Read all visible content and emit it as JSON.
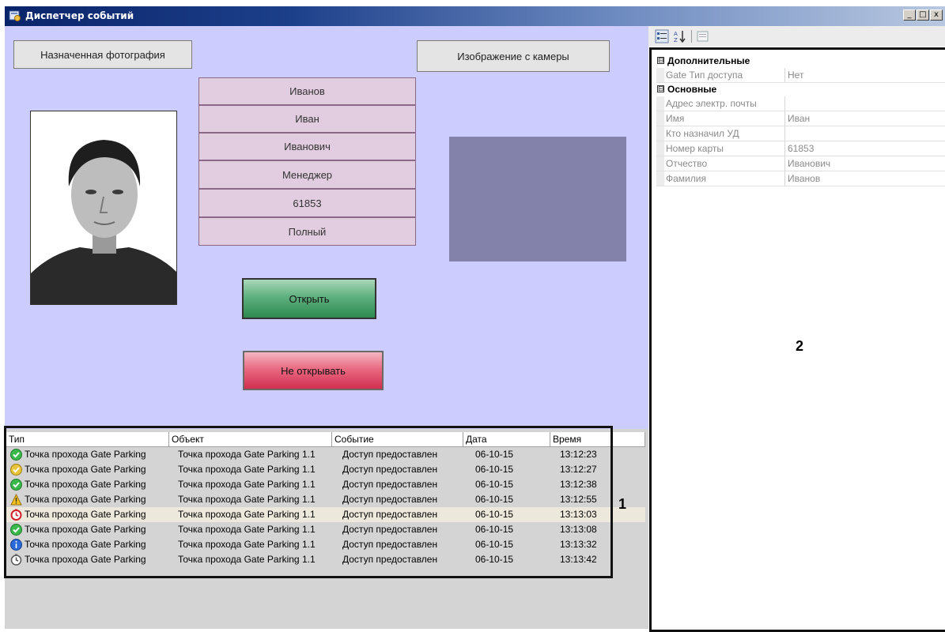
{
  "window": {
    "title": "Диспетчер событий",
    "min": "_",
    "max": "□",
    "close": "x"
  },
  "form": {
    "assigned_photo_label": "Назначенная фотография",
    "camera_image_label": "Изображение с камеры",
    "fields": [
      "Иванов",
      "Иван",
      "Иванович",
      "Менеджер",
      "61853",
      "Полный"
    ],
    "open_button": "Открыть",
    "deny_button": "Не открывать"
  },
  "events": {
    "columns": [
      "Тип",
      "Объект",
      "Событие",
      "Дата",
      "Время"
    ],
    "rows": [
      {
        "icon": "green-check-icon",
        "type": "Точка прохода Gate Parking",
        "object": "Точка прохода Gate Parking 1.1",
        "event": "Доступ предоставлен",
        "date": "06-10-15",
        "time": "13:12:23"
      },
      {
        "icon": "yellow-check-icon",
        "type": "Точка прохода Gate Parking",
        "object": "Точка прохода Gate Parking 1.1",
        "event": "Доступ предоставлен",
        "date": "06-10-15",
        "time": "13:12:27"
      },
      {
        "icon": "green-check-icon",
        "type": "Точка прохода Gate Parking",
        "object": "Точка прохода Gate Parking 1.1",
        "event": "Доступ предоставлен",
        "date": "06-10-15",
        "time": "13:12:38"
      },
      {
        "icon": "warning-icon",
        "type": "Точка прохода Gate Parking",
        "object": "Точка прохода Gate Parking 1.1",
        "event": "Доступ предоставлен",
        "date": "06-10-15",
        "time": "13:12:55"
      },
      {
        "icon": "red-clock-icon",
        "type": "Точка прохода Gate Parking",
        "object": "Точка прохода Gate Parking 1.1",
        "event": "Доступ предоставлен",
        "date": "06-10-15",
        "time": "13:13:03"
      },
      {
        "icon": "green-check-icon",
        "type": "Точка прохода Gate Parking",
        "object": "Точка прохода Gate Parking 1.1",
        "event": "Доступ предоставлен",
        "date": "06-10-15",
        "time": "13:13:08"
      },
      {
        "icon": "info-icon",
        "type": "Точка прохода Gate Parking",
        "object": "Точка прохода Gate Parking 1.1",
        "event": "Доступ предоставлен",
        "date": "06-10-15",
        "time": "13:13:32"
      },
      {
        "icon": "gray-clock-icon",
        "type": "Точка прохода Gate Parking",
        "object": "Точка прохода Gate Parking 1.1",
        "event": "Доступ предоставлен",
        "date": "06-10-15",
        "time": "13:13:42"
      }
    ]
  },
  "annotations": {
    "one": "1",
    "two": "2"
  },
  "properties": {
    "categories": [
      {
        "name": "Дополнительные",
        "expander": "⊟",
        "props": [
          {
            "name": "Gate Тип доступа",
            "value": "Нет"
          }
        ]
      },
      {
        "name": "Основные",
        "expander": "⊟",
        "props": [
          {
            "name": "Адрес электр. почты",
            "value": ""
          },
          {
            "name": "Имя",
            "value": "Иван"
          },
          {
            "name": "Кто назначил УД",
            "value": ""
          },
          {
            "name": "Номер карты",
            "value": "61853"
          },
          {
            "name": "Отчество",
            "value": "Иванович"
          },
          {
            "name": "Фамилия",
            "value": "Иванов"
          }
        ]
      }
    ]
  },
  "colors": {
    "form_bg": "#ccccff",
    "field_bg": "#e2cce0",
    "camera_bg": "#8282aa",
    "open_green": "#2d8a4f",
    "deny_red": "#d22f50"
  }
}
